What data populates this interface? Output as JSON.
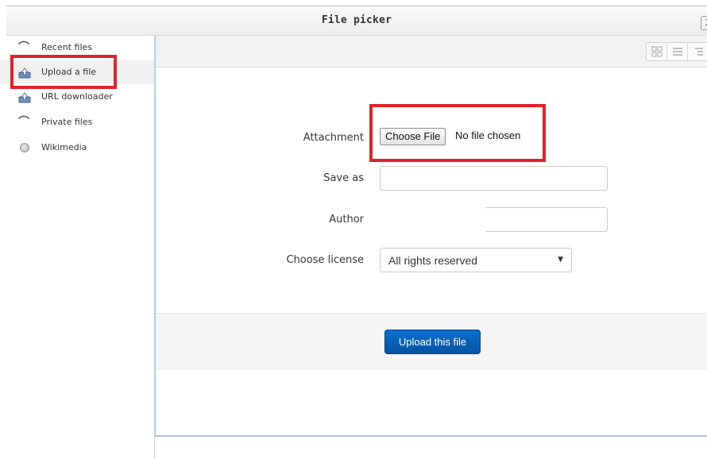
{
  "dialog": {
    "title": "File picker",
    "close_label": "X"
  },
  "sidebar": {
    "items": [
      {
        "label": "Recent files",
        "icon": "moodle-logo-icon",
        "active": false
      },
      {
        "label": "Upload a file",
        "icon": "upload-icon",
        "active": true
      },
      {
        "label": "URL downloader",
        "icon": "url-download-icon",
        "active": false
      },
      {
        "label": "Private files",
        "icon": "moodle-logo-icon",
        "active": false
      },
      {
        "label": "Wikimedia",
        "icon": "wikimedia-globe-icon",
        "active": false
      }
    ]
  },
  "toolbar": {
    "view_buttons": [
      "grid-view-icon",
      "list-view-icon",
      "tree-view-icon"
    ]
  },
  "form": {
    "attachment_label": "Attachment",
    "choose_file_label": "Choose File",
    "file_status": "No file chosen",
    "save_as_label": "Save as",
    "save_as_value": "",
    "author_label": "Author",
    "author_value": "",
    "license_label": "Choose license",
    "license_selected": "All rights reserved",
    "upload_button_label": "Upload this file"
  },
  "colors": {
    "highlight": "#e0212b",
    "primary_button": "#0a5fb4",
    "moodle_orange": "#f98012",
    "panel_border": "#a8c2ee"
  }
}
